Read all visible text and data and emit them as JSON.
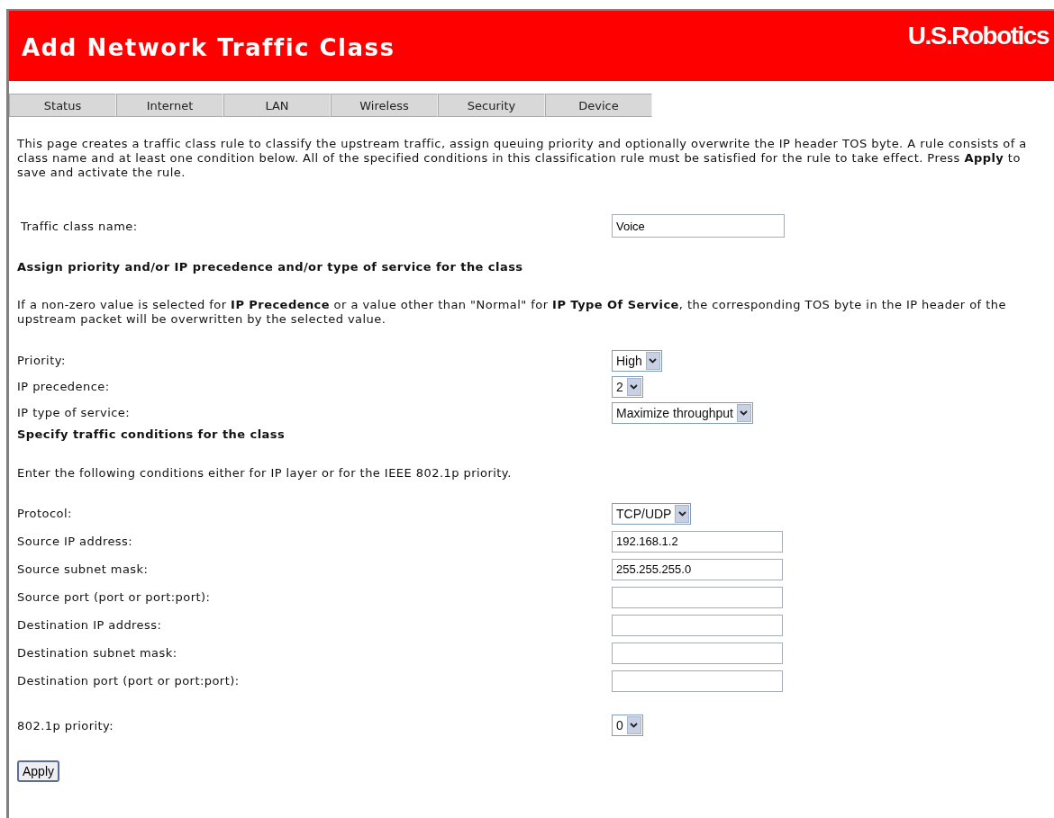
{
  "header": {
    "title": "Add Network Traffic Class",
    "logo": "U.S.Robotics"
  },
  "tabs": [
    {
      "label": "Status",
      "selected": false
    },
    {
      "label": "Internet",
      "selected": false
    },
    {
      "label": "LAN",
      "selected": false
    },
    {
      "label": "Wireless",
      "selected": false
    },
    {
      "label": "Security",
      "selected": false
    },
    {
      "label": "Device",
      "selected": false
    }
  ],
  "intro": "This page creates a traffic class rule to classify the upstream traffic, assign queuing priority and optionally overwrite the IP header TOS byte. A rule consists of a class name and at least one condition below. All of the specified conditions in this classification rule must be satisfied for the rule to take effect. Press **Apply** to save and activate the rule.",
  "class_name": {
    "label": "Traffic class name:",
    "value": "Voice"
  },
  "priority_section": {
    "heading": "Assign priority and/or IP precedence and/or type of service for the class",
    "note": "If a non-zero value is selected for **IP Precedence** or a value other than \"Normal\" for **IP Type Of Service**, the corresponding TOS byte in the IP header of the upstream packet will be overwritten by the selected value.",
    "fields": [
      {
        "label": "Priority:",
        "kind": "select",
        "value": "High"
      },
      {
        "label": "IP precedence:",
        "kind": "select",
        "value": "2"
      },
      {
        "label": "IP type of service:",
        "kind": "select",
        "value": "Maximize throughput"
      }
    ]
  },
  "conditions_section": {
    "heading": "Specify traffic conditions for the class",
    "note": "Enter the following conditions either for IP layer or for the IEEE 802.1p priority.",
    "fields": [
      {
        "label": "Protocol:",
        "kind": "select",
        "value": "TCP/UDP"
      },
      {
        "label": "Source IP address:",
        "kind": "text",
        "value": "192.168.1.2"
      },
      {
        "label": "Source subnet mask:",
        "kind": "text",
        "value": "255.255.255.0"
      },
      {
        "label": "Source port (port or port:port):",
        "kind": "text"
      },
      {
        "label": "Destination IP address:",
        "kind": "text"
      },
      {
        "label": "Destination subnet mask:",
        "kind": "text"
      },
      {
        "label": "Destination port (port or port:port):",
        "kind": "text"
      }
    ],
    "priority_8021p": {
      "label": "802.1p priority:",
      "kind": "select",
      "value": "0"
    }
  },
  "apply_button": "Apply"
}
